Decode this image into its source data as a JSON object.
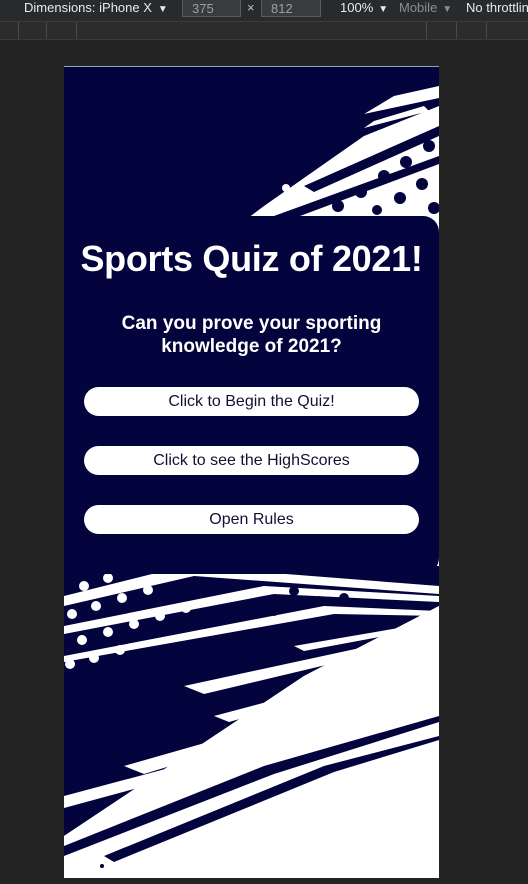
{
  "devtools": {
    "device_label": "Dimensions: iPhone X",
    "width_value": "375",
    "height_value": "812",
    "times_symbol": "×",
    "zoom_label": "100%",
    "mode_label": "Mobile",
    "throttle_label": "No throttlin",
    "caret": "▼"
  },
  "quiz": {
    "title": "Sports Quiz of 2021!",
    "subtitle": "Can you prove your sporting knowledge of 2021?",
    "begin_button": "Click to Begin the Quiz!",
    "highscores_button": "Click to see the HighScores",
    "rules_button": "Open Rules"
  },
  "colors": {
    "navy": "#03033d",
    "white": "#ffffff",
    "devtools_bg": "#242424"
  }
}
